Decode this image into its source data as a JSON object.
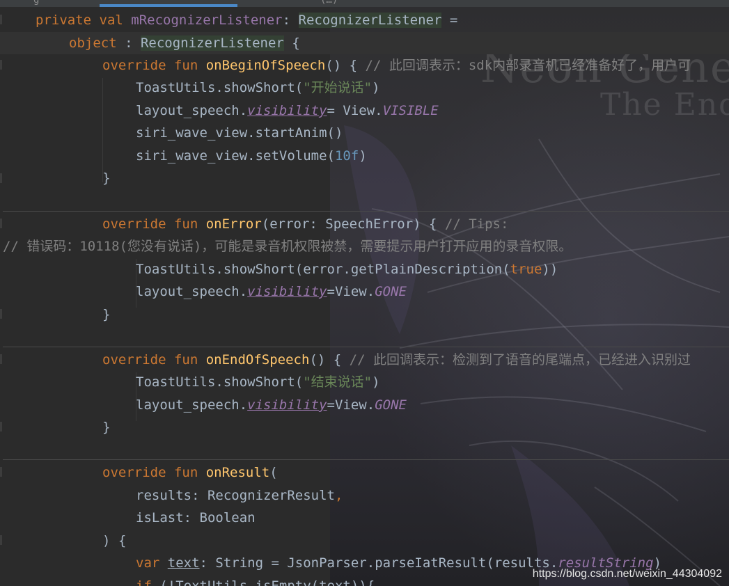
{
  "editor": {
    "background": {
      "title_line1": "Neon Gene",
      "title_line2": "The End"
    },
    "tabbar": {
      "glyph1": "g",
      "glyph2": "(…)"
    },
    "lines": {
      "l1": {
        "kw1": "private val ",
        "name": "mRecognizerListener",
        "colon": ": ",
        "type": "RecognizerListener",
        "eq": " ="
      },
      "l2": {
        "kw": "object",
        "rest": " : ",
        "type": "RecognizerListener",
        "brace": " {"
      },
      "l3": {
        "kw": "override fun ",
        "fn": "onBeginOfSpeech",
        "rest": "() { ",
        "comment": "// 此回调表示：sdk内部录音机已经准备好了，用户可"
      },
      "l4": {
        "pre": "ToastUtils.showShort(",
        "str": "\"开始说话\"",
        "post": ")"
      },
      "l5": {
        "pre": "layout_speech.",
        "prop": "visibility",
        "mid": "= View.",
        "field": "VISIBLE"
      },
      "l6": {
        "text": "siri_wave_view.startAnim()"
      },
      "l7": {
        "pre": "siri_wave_view.setVolume(",
        "num": "10f",
        "post": ")"
      },
      "l8": {
        "text": "}"
      },
      "l9": {
        "kw": "override fun ",
        "fn": "onError",
        "rest": "(error: SpeechError) { ",
        "comment": "// Tips:"
      },
      "l10": {
        "comment": "// 错误码：10118(您没有说话)，可能是录音机权限被禁，需要提示用户打开应用的录音权限。"
      },
      "l11": {
        "pre": "ToastUtils.showShort(error.getPlainDescription(",
        "kw": "true",
        "post": "))"
      },
      "l12": {
        "pre": "layout_speech.",
        "prop": "visibility",
        "mid": "=View.",
        "field": "GONE"
      },
      "l13": {
        "text": "}"
      },
      "l14": {
        "kw": "override fun ",
        "fn": "onEndOfSpeech",
        "rest": "() { ",
        "comment": "// 此回调表示：检测到了语音的尾端点，已经进入识别过"
      },
      "l15": {
        "pre": "ToastUtils.showShort(",
        "str": "\"结束说话\"",
        "post": ")"
      },
      "l16": {
        "pre": "layout_speech.",
        "prop": "visibility",
        "mid": "=View.",
        "field": "GONE"
      },
      "l17": {
        "text": "}"
      },
      "l18": {
        "kw": "override fun ",
        "fn": "onResult",
        "rest": "("
      },
      "l19": {
        "text": "results: RecognizerResult",
        "comma": ","
      },
      "l20": {
        "text": "isLast: Boolean"
      },
      "l21": {
        "text": ") {"
      },
      "l22": {
        "kw": "var ",
        "name": "text",
        "rest": ": String = JsonParser.parseIatResult(results.",
        "prop": "resultString",
        "post": ")"
      },
      "l23": {
        "kw": "if ",
        "rest": "(!TextUtils.isEmpty(text)){"
      }
    }
  },
  "watermark": "https://blog.csdn.net/weixin_44304092",
  "colors": {
    "keyword": "#cc7832",
    "function": "#ffc66d",
    "string": "#6a8759",
    "comment": "#808080",
    "number": "#6897bb",
    "property": "#9876aa",
    "text": "#a9b7c6",
    "background": "#2b2b2b"
  }
}
